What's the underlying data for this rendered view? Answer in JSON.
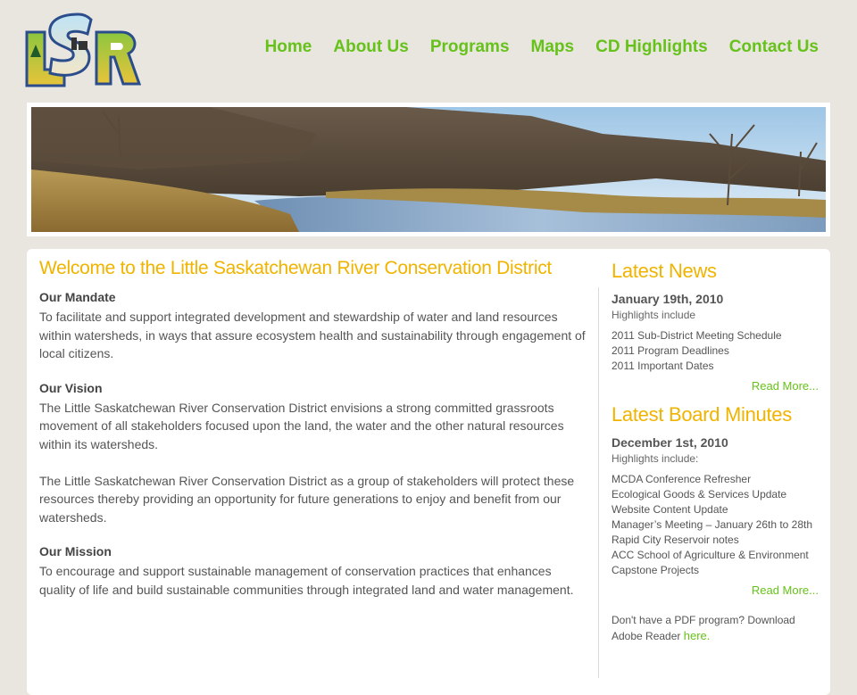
{
  "logo": {
    "text": "LSR"
  },
  "nav": {
    "items": [
      {
        "label": "Home"
      },
      {
        "label": "About Us"
      },
      {
        "label": "Programs"
      },
      {
        "label": "Maps"
      },
      {
        "label": "CD Highlights"
      },
      {
        "label": "Contact Us"
      }
    ]
  },
  "main": {
    "title": "Welcome to the Little Saskatchewan River Conservation District",
    "mandate_heading": "Our Mandate",
    "mandate_text": "To facilitate and support integrated development and stewardship of water and land resources within watersheds, in ways that assure ecosystem health and sustainability through engagement of local citizens.",
    "vision_heading": "Our Vision",
    "vision_text_1": "The Little Saskatchewan River Conservation District envisions a strong committed grassroots movement of all stakeholders focused upon the land, the water and the other natural resources within its watersheds.",
    "vision_text_2": "The Little Saskatchewan River Conservation District as a group of stakeholders will protect these resources thereby providing an opportunity for future generations to enjoy and benefit from our watersheds.",
    "mission_heading": "Our Mission",
    "mission_text": "To encourage and support sustainable management of conservation practices that enhances quality of life and build sustainable communities through integrated land and water management."
  },
  "news": {
    "title": "Latest News",
    "date": "January 19th, 2010",
    "highlights": "Highlights include",
    "items": [
      "2011 Sub-District Meeting Schedule",
      "2011 Program Deadlines",
      "2011 Important Dates"
    ],
    "read_more": "Read More..."
  },
  "minutes": {
    "title": "Latest Board Minutes",
    "date": "December 1st, 2010",
    "highlights": "Highlights include:",
    "items": [
      "MCDA Conference Refresher",
      "Ecological Goods & Services Update",
      "Website Content Update",
      "Manager’s Meeting – January 26th to 28th",
      "Rapid City Reservoir notes",
      "ACC School of Agriculture & Environment",
      "Capstone Projects"
    ],
    "read_more": "Read More..."
  },
  "pdf": {
    "text": "Don't have a PDF program? Download Adobe Reader",
    "link": "here."
  },
  "colors": {
    "accent_green": "#66c21a",
    "heading_gold": "#f0b400",
    "page_bg": "#e9e6df"
  }
}
